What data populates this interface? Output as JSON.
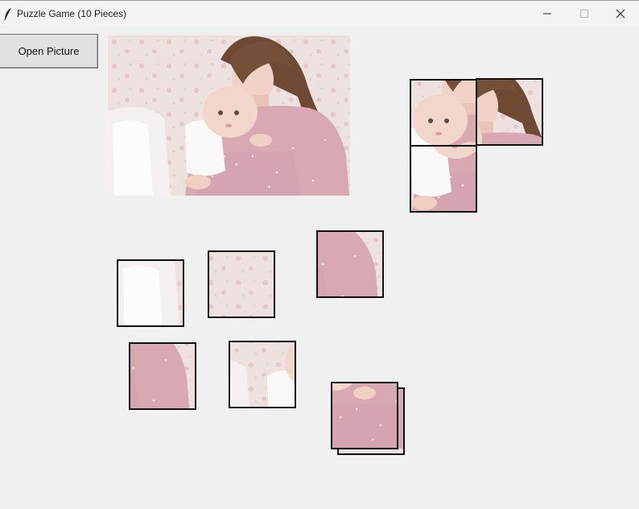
{
  "window": {
    "title": "Puzzle Game (10 Pieces)",
    "app_icon": "feather-icon",
    "controls": [
      "minimize-icon",
      "maximize-icon",
      "close-icon"
    ]
  },
  "toolbar": {
    "open_label": "Open Picture"
  },
  "puzzle": {
    "piece_count": 10,
    "image_subject": "mother holding newborn baby"
  },
  "colors": {
    "background": "#f0f0f0",
    "sweater": "#d9aab4",
    "wall": "#efe2e0",
    "hair": "#6e4a35",
    "skin": "#f0cfc4",
    "border": "#111111"
  }
}
